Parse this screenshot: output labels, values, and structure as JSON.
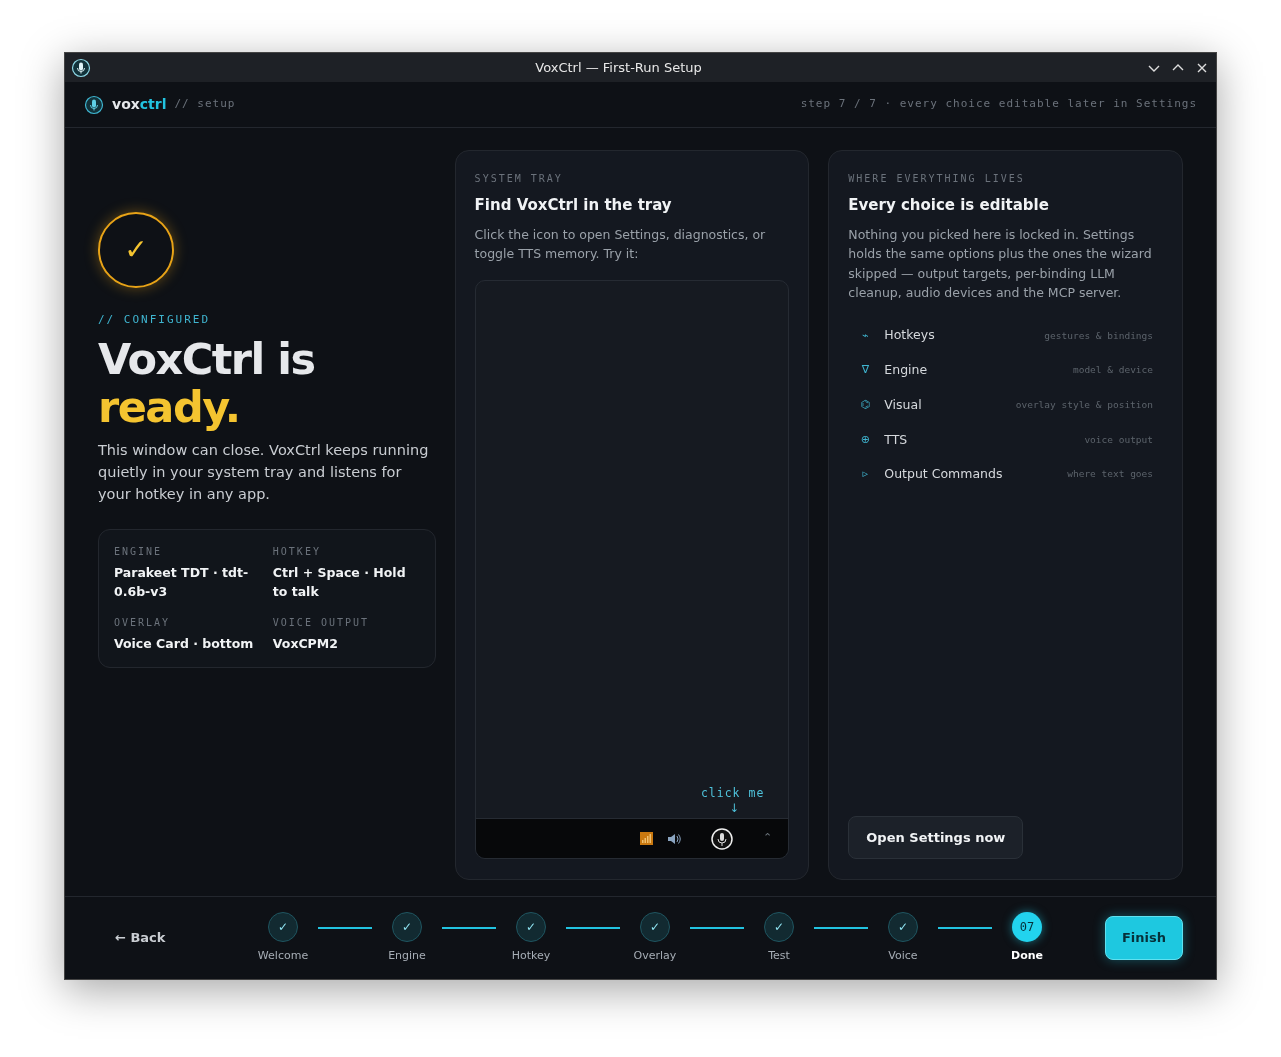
{
  "window": {
    "title": "VoxCtrl — First-Run Setup"
  },
  "header": {
    "brand_lead": "vox",
    "brand_accent": "ctrl",
    "section": "// setup",
    "step_info": "step 7 / 7 · every choice editable later in Settings"
  },
  "hero": {
    "check": "✓",
    "eyebrow": "// CONFIGURED",
    "title_lead": "VoxCtrl is",
    "title_accent": "ready.",
    "body": "This window can close. VoxCtrl keeps running quietly in your system tray and listens for your hotkey in any app."
  },
  "summary": [
    {
      "label": "ENGINE",
      "value": "Parakeet TDT · tdt-0.6b-v3"
    },
    {
      "label": "HOTKEY",
      "value": "Ctrl + Space · Hold to talk"
    },
    {
      "label": "OVERLAY",
      "value": "Voice Card · bottom"
    },
    {
      "label": "VOICE OUTPUT",
      "value": "VoxCPM2"
    }
  ],
  "tray_card": {
    "eyebrow": "SYSTEM TRAY",
    "title": "Find VoxCtrl in the tray",
    "body": "Click the icon to open Settings, diagnostics, or toggle TTS memory. Try it:",
    "hint": "click me",
    "hint_arrow": "↓",
    "caret": "⌃"
  },
  "settings_card": {
    "eyebrow": "WHERE EVERYTHING LIVES",
    "title": "Every choice is editable",
    "body": "Nothing you picked here is locked in. Settings holds the same options plus the ones the wizard skipped — output targets, per-binding LLM cleanup, audio devices and the MCP server.",
    "button": "Open Settings now"
  },
  "settings_items": [
    {
      "glyph": "⌁",
      "name": "Hotkeys",
      "hint": "gestures & bindings"
    },
    {
      "glyph": "∇",
      "name": "Engine",
      "hint": "model & device"
    },
    {
      "glyph": "⌬",
      "name": "Visual",
      "hint": "overlay style & position"
    },
    {
      "glyph": "⊕",
      "name": "TTS",
      "hint": "voice output"
    },
    {
      "glyph": "▹",
      "name": "Output Commands",
      "hint": "where text goes"
    }
  ],
  "footer": {
    "back": "← Back",
    "finish": "Finish"
  },
  "steps": [
    {
      "marker": "✓",
      "label": "Welcome",
      "selected": false
    },
    {
      "marker": "✓",
      "label": "Engine",
      "selected": false
    },
    {
      "marker": "✓",
      "label": "Hotkey",
      "selected": false
    },
    {
      "marker": "✓",
      "label": "Overlay",
      "selected": false
    },
    {
      "marker": "✓",
      "label": "Test",
      "selected": false
    },
    {
      "marker": "✓",
      "label": "Voice",
      "selected": false
    },
    {
      "marker": "07",
      "label": "Done",
      "selected": true
    }
  ]
}
